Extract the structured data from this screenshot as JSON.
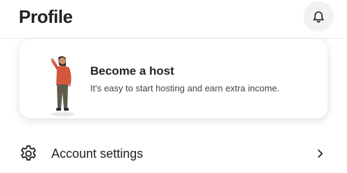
{
  "header": {
    "title": "Profile",
    "notifications_icon": "bell-icon"
  },
  "host_card": {
    "title": "Become a host",
    "subtitle": "It's easy to start hosting and earn extra income.",
    "illustration": "host-person-illustration"
  },
  "menu": {
    "items": [
      {
        "label": "Account settings",
        "icon": "gear-icon",
        "trailing_icon": "chevron-right-icon"
      }
    ]
  },
  "colors": {
    "text_primary": "#222222",
    "text_secondary": "#444444",
    "icon_button_bg": "#f2f2f2",
    "divider": "#ebebeb",
    "illustration_shirt": "#d4573d",
    "illustration_pants": "#5f5a4a"
  }
}
